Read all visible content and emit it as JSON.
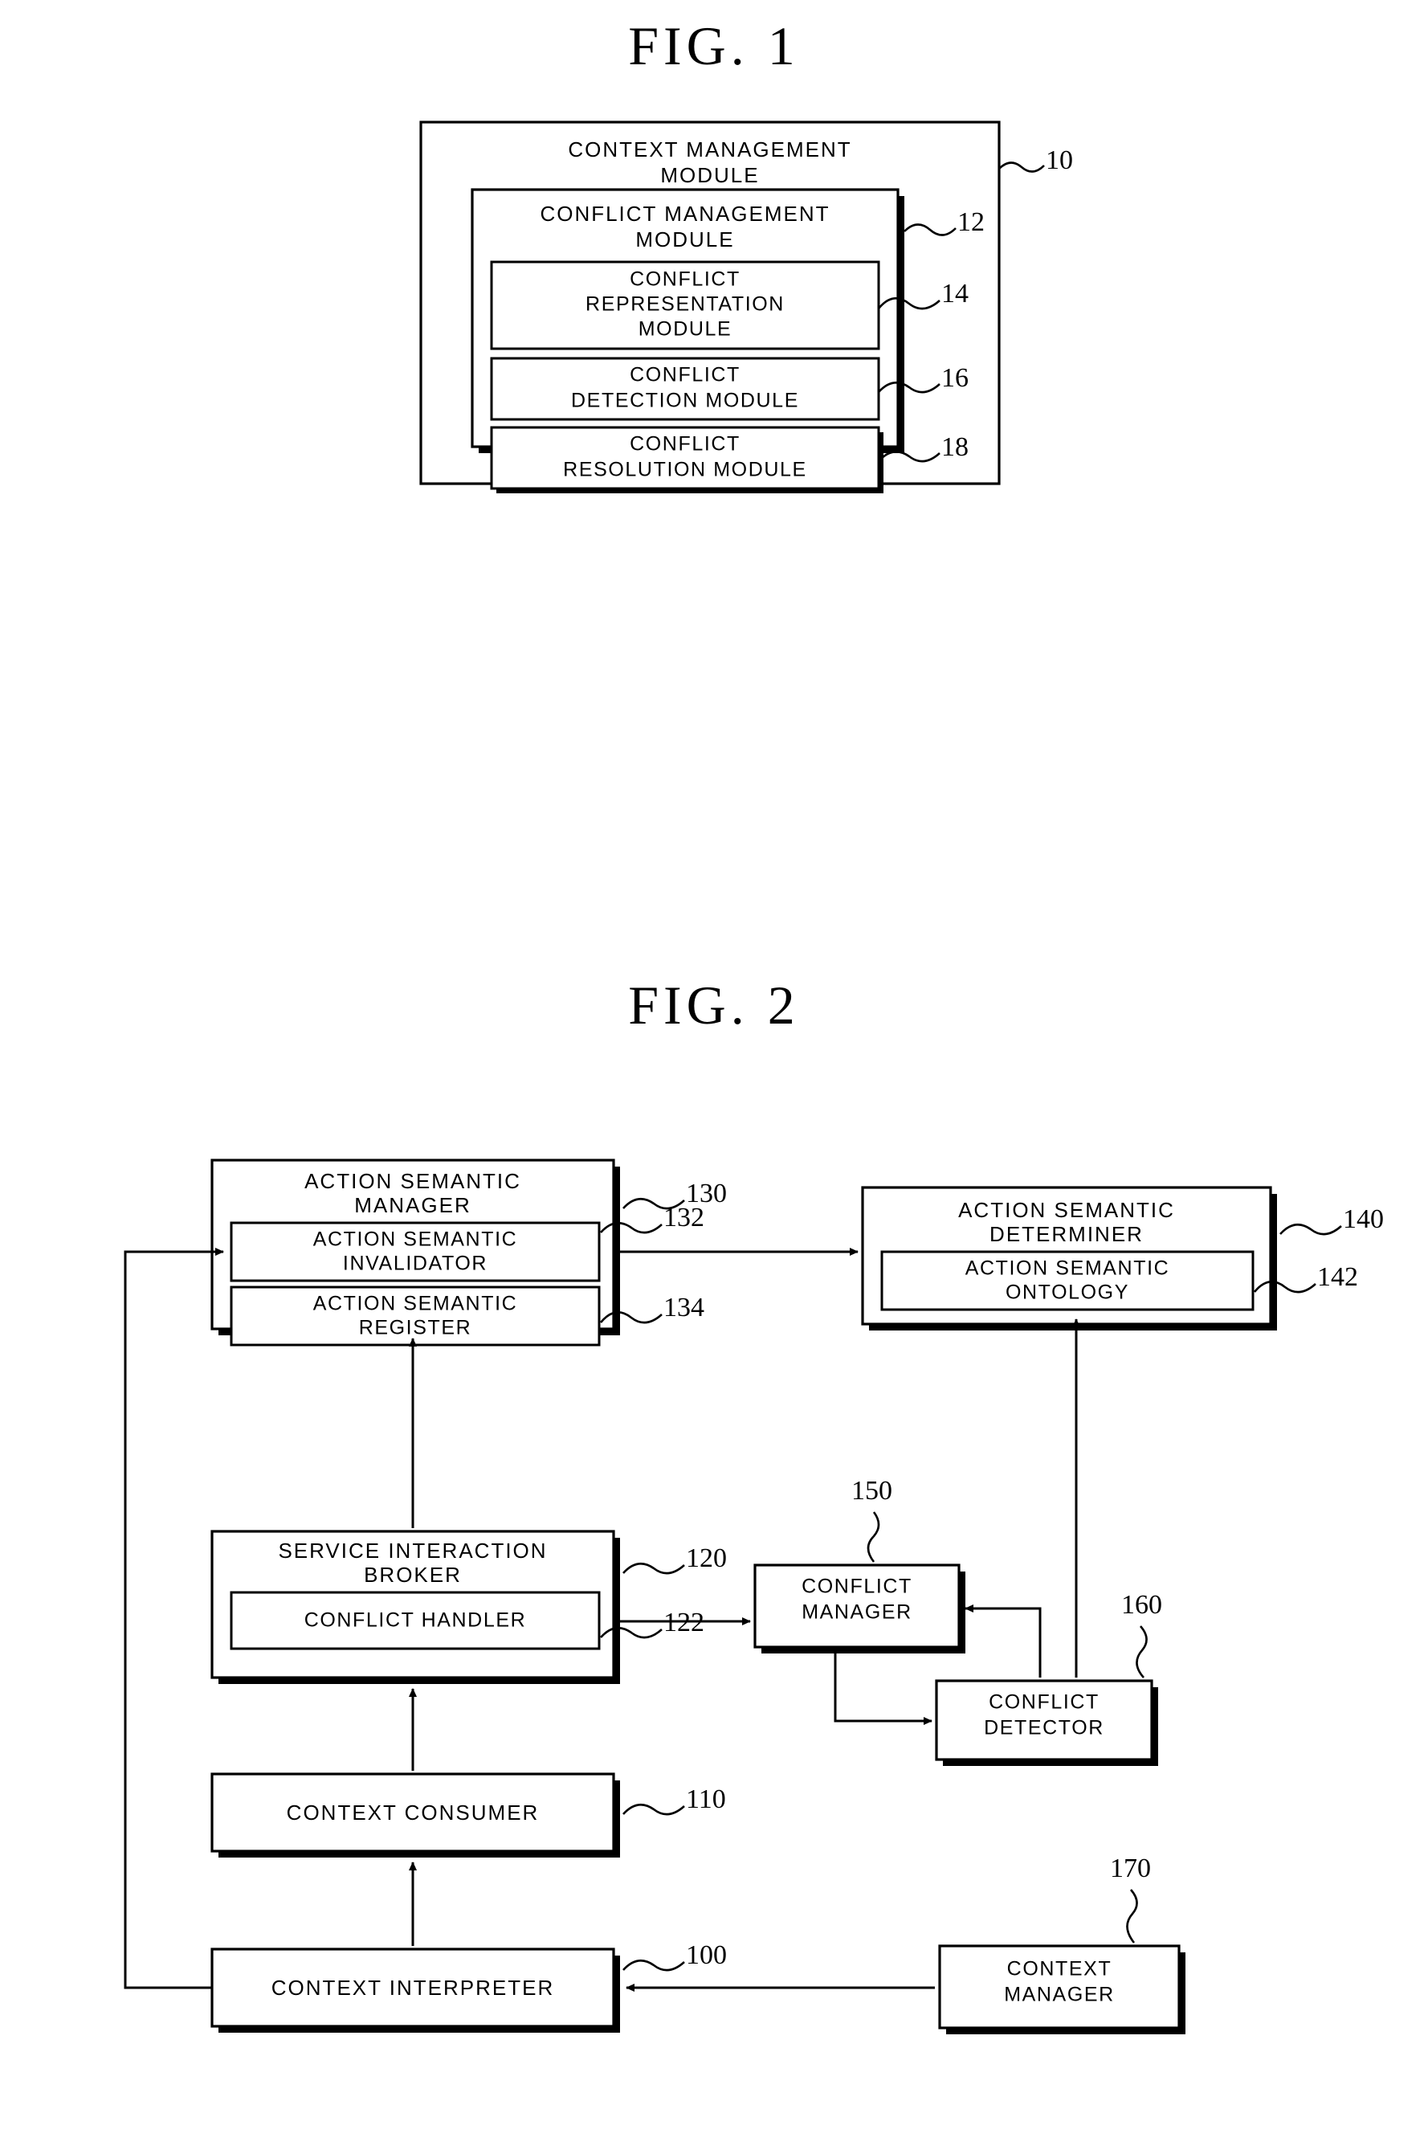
{
  "figures": [
    {
      "id": "fig1",
      "title": "FIG.  1",
      "boxes": [
        {
          "ref": "10",
          "label_lines": [
            "CONTEXT MANAGEMENT",
            "MODULE"
          ]
        },
        {
          "ref": "12",
          "label_lines": [
            "CONFLICT MANAGEMENT",
            "MODULE"
          ]
        },
        {
          "ref": "14",
          "label_lines": [
            "CONFLICT",
            "REPRESENTATION",
            "MODULE"
          ]
        },
        {
          "ref": "16",
          "label_lines": [
            "CONFLICT",
            "DETECTION MODULE"
          ]
        },
        {
          "ref": "18",
          "label_lines": [
            "CONFLICT",
            "RESOLUTION MODULE"
          ]
        }
      ]
    },
    {
      "id": "fig2",
      "title": "FIG.  2",
      "boxes": [
        {
          "ref": "130",
          "label_lines": [
            "ACTION SEMANTIC",
            "MANAGER"
          ]
        },
        {
          "ref": "132",
          "label_lines": [
            "ACTION SEMANTIC",
            "INVALIDATOR"
          ]
        },
        {
          "ref": "134",
          "label_lines": [
            "ACTION SEMANTIC",
            "REGISTER"
          ]
        },
        {
          "ref": "140",
          "label_lines": [
            "ACTION SEMANTIC",
            "DETERMINER"
          ]
        },
        {
          "ref": "142",
          "label_lines": [
            "ACTION SEMANTIC",
            "ONTOLOGY"
          ]
        },
        {
          "ref": "120",
          "label_lines": [
            "SERVICE INTERACTION",
            "BROKER"
          ]
        },
        {
          "ref": "122",
          "label_lines": [
            "CONFLICT HANDLER"
          ]
        },
        {
          "ref": "150",
          "label_lines": [
            "CONFLICT",
            "MANAGER"
          ]
        },
        {
          "ref": "160",
          "label_lines": [
            "CONFLICT",
            "DETECTOR"
          ]
        },
        {
          "ref": "110",
          "label_lines": [
            "CONTEXT CONSUMER"
          ]
        },
        {
          "ref": "100",
          "label_lines": [
            "CONTEXT INTERPRETER"
          ]
        },
        {
          "ref": "170",
          "label_lines": [
            "CONTEXT",
            "MANAGER"
          ]
        }
      ]
    }
  ],
  "fig1": {
    "title": "FIG.  1",
    "outer": {
      "ref": "10",
      "line1": "CONTEXT MANAGEMENT",
      "line2": "MODULE"
    },
    "conflict_mgmt": {
      "ref": "12",
      "line1": "CONFLICT MANAGEMENT",
      "line2": "MODULE"
    },
    "representation": {
      "ref": "14",
      "line1": "CONFLICT",
      "line2": "REPRESENTATION",
      "line3": "MODULE"
    },
    "detection": {
      "ref": "16",
      "line1": "CONFLICT",
      "line2": "DETECTION MODULE"
    },
    "resolution": {
      "ref": "18",
      "line1": "CONFLICT",
      "line2": "RESOLUTION MODULE"
    }
  },
  "fig2": {
    "title": "FIG.  2",
    "action_semantic_manager": {
      "ref": "130",
      "line1": "ACTION SEMANTIC",
      "line2": "MANAGER"
    },
    "action_semantic_invalidator": {
      "ref": "132",
      "line1": "ACTION SEMANTIC",
      "line2": "INVALIDATOR"
    },
    "action_semantic_register": {
      "ref": "134",
      "line1": "ACTION SEMANTIC",
      "line2": "REGISTER"
    },
    "action_semantic_determiner": {
      "ref": "140",
      "line1": "ACTION SEMANTIC",
      "line2": "DETERMINER"
    },
    "action_semantic_ontology": {
      "ref": "142",
      "line1": "ACTION SEMANTIC",
      "line2": "ONTOLOGY"
    },
    "service_interaction_broker": {
      "ref": "120",
      "line1": "SERVICE INTERACTION",
      "line2": "BROKER"
    },
    "conflict_handler": {
      "ref": "122",
      "line1": "CONFLICT HANDLER"
    },
    "conflict_manager": {
      "ref": "150",
      "line1": "CONFLICT",
      "line2": "MANAGER"
    },
    "conflict_detector": {
      "ref": "160",
      "line1": "CONFLICT",
      "line2": "DETECTOR"
    },
    "context_consumer": {
      "ref": "110",
      "line1": "CONTEXT CONSUMER"
    },
    "context_interpreter": {
      "ref": "100",
      "line1": "CONTEXT INTERPRETER"
    },
    "context_manager": {
      "ref": "170",
      "line1": "CONTEXT",
      "line2": "MANAGER"
    }
  }
}
